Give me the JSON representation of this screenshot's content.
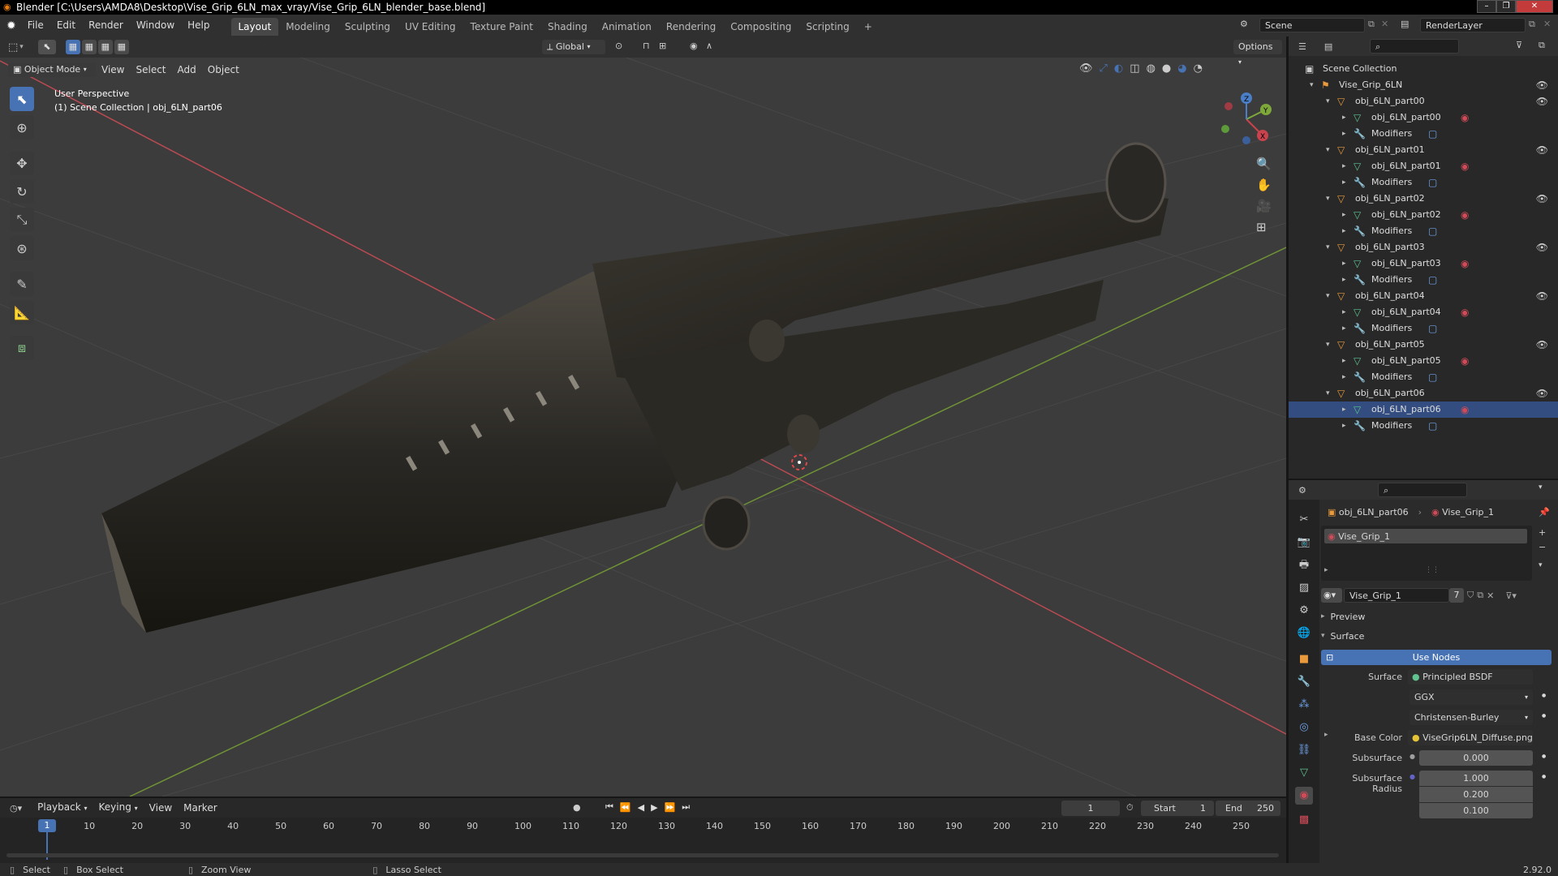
{
  "window": {
    "title": "Blender [C:\\Users\\AMDA8\\Desktop\\Vise_Grip_6LN_max_vray/Vise_Grip_6LN_blender_base.blend]",
    "controls": [
      "–",
      "❐",
      "✕"
    ]
  },
  "menu": [
    "File",
    "Edit",
    "Render",
    "Window",
    "Help"
  ],
  "workspaces": [
    {
      "label": "Layout",
      "active": true
    },
    {
      "label": "Modeling",
      "active": false
    },
    {
      "label": "Sculpting",
      "active": false
    },
    {
      "label": "UV Editing",
      "active": false
    },
    {
      "label": "Texture Paint",
      "active": false
    },
    {
      "label": "Shading",
      "active": false
    },
    {
      "label": "Animation",
      "active": false
    },
    {
      "label": "Rendering",
      "active": false
    },
    {
      "label": "Compositing",
      "active": false
    },
    {
      "label": "Scripting",
      "active": false
    }
  ],
  "add_workspace": "+",
  "scene": {
    "name": "Scene",
    "render_layer": "RenderLayer"
  },
  "header_tools": {
    "transform_orientation": "Global",
    "options_label": "Options"
  },
  "viewport": {
    "mode": "Object Mode",
    "menus": [
      "View",
      "Select",
      "Add",
      "Object"
    ],
    "overlay_title": "User Perspective",
    "overlay_subtitle": "(1) Scene Collection | obj_6LN_part06",
    "gizmo_axes": {
      "x": "X",
      "y": "Y",
      "z": "Z"
    }
  },
  "outliner": {
    "search_placeholder": "",
    "root": "Scene Collection",
    "collection": "Vise_Grip_6LN",
    "objects": [
      {
        "name": "obj_6LN_part00",
        "mesh": "obj_6LN_part00",
        "modifiers": "Modifiers",
        "selected": false
      },
      {
        "name": "obj_6LN_part01",
        "mesh": "obj_6LN_part01",
        "modifiers": "Modifiers",
        "selected": false
      },
      {
        "name": "obj_6LN_part02",
        "mesh": "obj_6LN_part02",
        "modifiers": "Modifiers",
        "selected": false
      },
      {
        "name": "obj_6LN_part03",
        "mesh": "obj_6LN_part03",
        "modifiers": "Modifiers",
        "selected": false
      },
      {
        "name": "obj_6LN_part04",
        "mesh": "obj_6LN_part04",
        "modifiers": "Modifiers",
        "selected": false
      },
      {
        "name": "obj_6LN_part05",
        "mesh": "obj_6LN_part05",
        "modifiers": "Modifiers",
        "selected": false
      },
      {
        "name": "obj_6LN_part06",
        "mesh": "obj_6LN_part06",
        "modifiers": "Modifiers",
        "selected": true
      }
    ]
  },
  "properties": {
    "breadcrumb_object": "obj_6LN_part06",
    "breadcrumb_material": "Vise_Grip_1",
    "slot_name": "Vise_Grip_1",
    "material_name": "Vise_Grip_1",
    "user_count": "7",
    "panels": {
      "preview": "Preview",
      "surface": "Surface"
    },
    "use_nodes": "Use Nodes",
    "surface_label": "Surface",
    "surface_value": "Principled BSDF",
    "distribution": "GGX",
    "subsurface_method": "Christensen-Burley",
    "base_color_label": "Base Color",
    "base_color_value": "ViseGrip6LN_Diffuse.png",
    "subsurface_label": "Subsurface",
    "subsurface_value": "0.000",
    "subsurface_radius_label": "Subsurface Radius",
    "subsurface_radius": [
      "1.000",
      "0.200",
      "0.100"
    ]
  },
  "timeline": {
    "menus": [
      "Playback",
      "Keying",
      "View",
      "Marker"
    ],
    "current_frame": "1",
    "start_label": "Start",
    "start": "1",
    "end_label": "End",
    "end": "250",
    "ticks": [
      "10",
      "20",
      "30",
      "40",
      "50",
      "60",
      "70",
      "80",
      "90",
      "100",
      "110",
      "120",
      "130",
      "140",
      "150",
      "160",
      "170",
      "180",
      "190",
      "200",
      "210",
      "220",
      "230",
      "240",
      "250"
    ]
  },
  "status_bar": {
    "select": "Select",
    "box_select": "Box Select",
    "zoom_view": "Zoom View",
    "lasso_select": "Lasso Select",
    "version": "2.92.0"
  },
  "colors": {
    "accent": "#4772b3",
    "selection": "#334d80",
    "x_axis": "#c8434e",
    "y_axis": "#7fa83a",
    "z_axis": "#4a7ec7",
    "object_orange": "#e89a3c",
    "mesh_green": "#5fc28f",
    "modifier_blue": "#6fa1e6",
    "material_red": "#d04b58"
  }
}
